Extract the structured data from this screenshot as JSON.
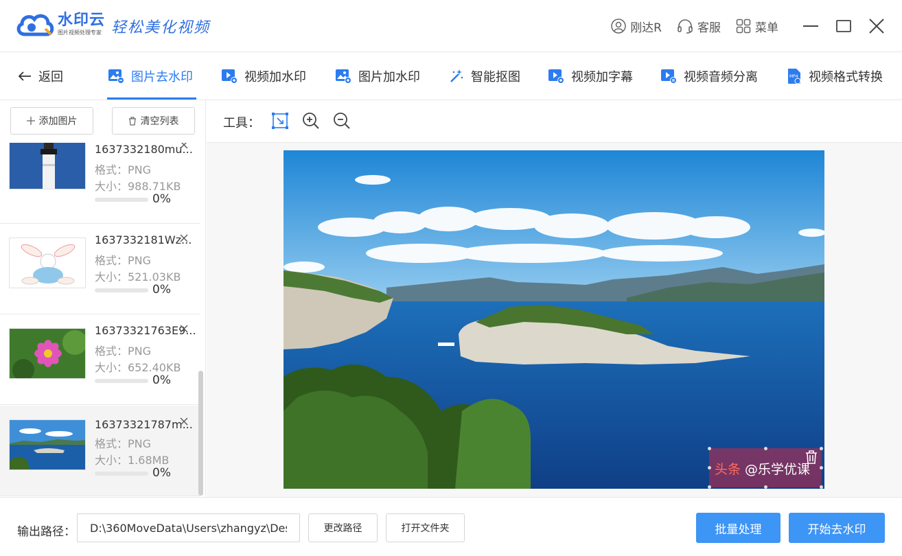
{
  "app": {
    "name": "水印云",
    "subtitle": "图片视频处理专家",
    "slogan": "轻松美化视频",
    "colors": {
      "brand": "#2f6fe0",
      "accent": "#2c7cf0",
      "primary_button": "#3d95f5"
    }
  },
  "titlebar": {
    "user": {
      "label": "刚达R",
      "icon": "user-icon"
    },
    "service": {
      "label": "客服",
      "icon": "headset-icon"
    },
    "menu": {
      "label": "菜单",
      "icon": "grid-icon"
    }
  },
  "nav": {
    "back_label": "返回",
    "tabs": [
      {
        "label": "图片去水印",
        "icon": "image-remove-icon",
        "active": true
      },
      {
        "label": "视频加水印",
        "icon": "video-add-icon",
        "active": false
      },
      {
        "label": "图片加水印",
        "icon": "image-add-icon",
        "active": false
      },
      {
        "label": "智能抠图",
        "icon": "magic-wand-icon",
        "active": false
      },
      {
        "label": "视频加字幕",
        "icon": "video-subtitle-icon",
        "active": false
      },
      {
        "label": "视频音频分离",
        "icon": "video-audio-icon",
        "active": false
      },
      {
        "label": "视频格式转换",
        "icon": "mp4-icon",
        "active": false
      }
    ]
  },
  "sidebar": {
    "add_label": "添加图片",
    "clear_label": "清空列表",
    "files": [
      {
        "name": "1637332180mu...",
        "format": "格式：PNG",
        "size": "大小：988.71KB",
        "progress_pct": 0,
        "progress_label": "0%"
      },
      {
        "name": "1637332181Wz...",
        "format": "格式：PNG",
        "size": "大小：521.03KB",
        "progress_pct": 0,
        "progress_label": "0%"
      },
      {
        "name": "16373321763E9...",
        "format": "格式：PNG",
        "size": "大小：652.40KB",
        "progress_pct": 0,
        "progress_label": "0%"
      },
      {
        "name": "16373321787m...",
        "format": "格式：PNG",
        "size": "大小：1.68MB",
        "progress_pct": 0,
        "progress_label": "0%"
      }
    ]
  },
  "tools": {
    "label": "工具："
  },
  "watermark": {
    "part1": "头条",
    "part2": " @乐学优课"
  },
  "bottom": {
    "output_label": "输出路径：",
    "output_path": "D:\\360MoveData\\Users\\zhangyz\\Des",
    "change_path_label": "更改路径",
    "open_folder_label": "打开文件夹",
    "batch_label": "批量处理",
    "start_label": "开始去水印"
  }
}
